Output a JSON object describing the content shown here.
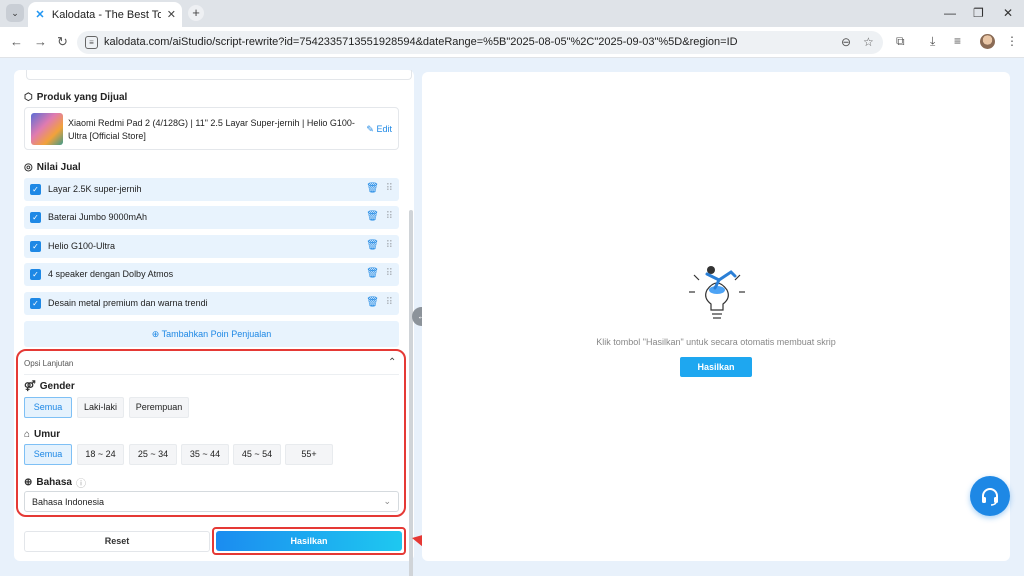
{
  "browser": {
    "tab_search_glyph": "⌄",
    "tab_title": "Kalodata - The Best Tool for TikTok",
    "tab_close": "✕",
    "new_tab": "+",
    "url": "kalodata.com/aiStudio/script-rewrite?id=7542335713551928594&dateRange=%5B\"2025-08-05\"%2C\"2025-09-03\"%5D&region=ID"
  },
  "product_section": {
    "title": "Produk yang Dijual",
    "product_name": "Xiaomi Redmi Pad 2 (4/128G) | 11\" 2.5 Layar Super-jernih | Helio G100-Ultra [Official Store]",
    "edit_label": "Edit"
  },
  "selling_points": {
    "title": "Nilai Jual",
    "items": [
      {
        "label": "Layar 2.5K super-jernih"
      },
      {
        "label": "Baterai Jumbo 9000mAh"
      },
      {
        "label": "Helio G100-Ultra"
      },
      {
        "label": "4 speaker dengan Dolby Atmos"
      },
      {
        "label": "Desain metal premium dan warna trendi"
      }
    ],
    "add_label": "⊕ Tambahkan Poin Penjualan"
  },
  "advanced": {
    "title": "Opsi Lanjutan",
    "gender": {
      "label": "Gender",
      "options": [
        "Semua",
        "Laki-laki",
        "Perempuan"
      ],
      "selected": "Semua"
    },
    "age": {
      "label": "Umur",
      "options": [
        "Semua",
        "18 ~ 24",
        "25 ~ 34",
        "35 ~ 44",
        "45 ~ 54",
        "55+"
      ],
      "selected": "Semua"
    },
    "language": {
      "label": "Bahasa",
      "value": "Bahasa Indonesia"
    }
  },
  "actions": {
    "reset_label": "Reset",
    "generate_label": "Hasilkan"
  },
  "right_panel": {
    "hint": "Klik tombol \"Hasilkan\" untuk secara otomatis membuat skrip",
    "button_label": "Hasilkan"
  },
  "colors": {
    "accent": "#1e88e5",
    "highlight": "#e53935"
  }
}
